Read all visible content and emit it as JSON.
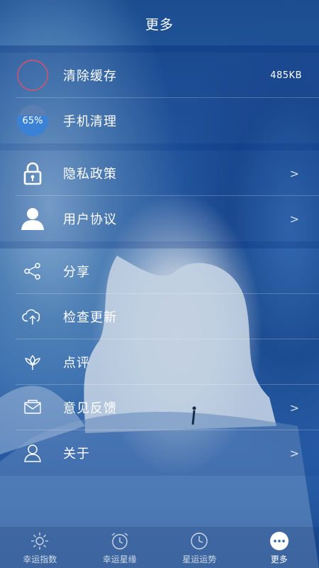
{
  "header": {
    "title": "更多"
  },
  "menu": {
    "clear_cache": {
      "label": "清除缓存",
      "size": "485KB"
    },
    "phone_clean": {
      "label": "手机清理",
      "percent": "65%"
    },
    "privacy": {
      "label": "隐私政策"
    },
    "user_agreement": {
      "label": "用户协议"
    },
    "share": {
      "label": "分享"
    },
    "check_update": {
      "label": "检查更新"
    },
    "rate": {
      "label": "点评"
    },
    "feedback": {
      "label": "意见反馈"
    },
    "about": {
      "label": "关于"
    }
  },
  "tabs": [
    {
      "label": "幸运指数",
      "icon": "sun-icon"
    },
    {
      "label": "幸运星缘",
      "icon": "alarm-clock-icon"
    },
    {
      "label": "星运运势",
      "icon": "clock-icon"
    },
    {
      "label": "更多",
      "icon": "more-icon",
      "active": true
    }
  ],
  "colors": {
    "accent_ring": "#e0506a",
    "progress_blue": "#3b82d6"
  }
}
